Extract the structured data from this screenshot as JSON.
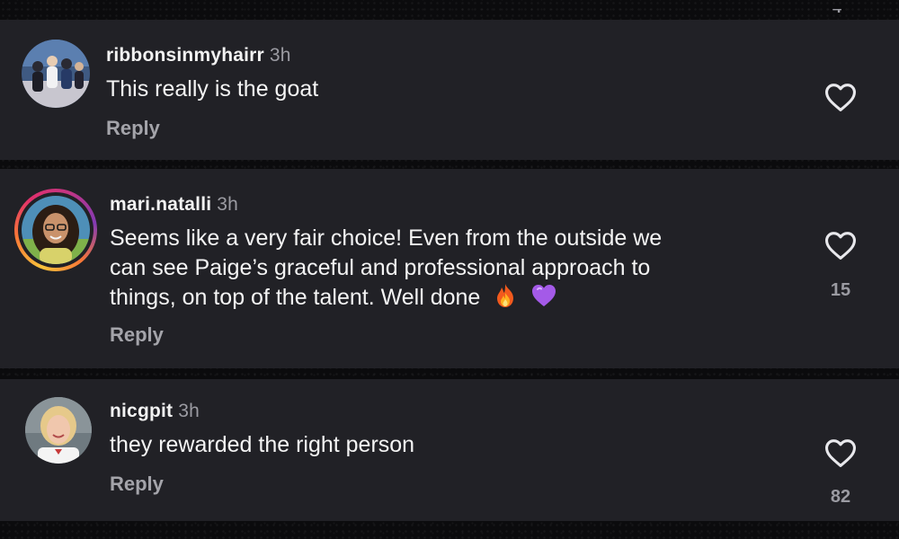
{
  "header_partial": {
    "count": "4"
  },
  "comments": [
    {
      "username": "ribbonsinmyhairr",
      "time": "3h",
      "text_lines": [
        "This really is the goat"
      ],
      "reply_label": "Reply",
      "like_count": "",
      "has_story_ring": false,
      "avatar_icon": "group-photo-avatar"
    },
    {
      "username": "mari.natalli",
      "time": "3h",
      "text_lines": [
        "Seems like a very fair choice! Even from the outside we",
        "can see Paige’s graceful and professional approach to",
        "things, on top of the talent. Well done"
      ],
      "emojis": [
        "fire-emoji",
        "purple-heart-emoji"
      ],
      "reply_label": "Reply",
      "like_count": "15",
      "has_story_ring": true,
      "avatar_icon": "woman-glasses-avatar"
    },
    {
      "username": "nicgpit",
      "time": "3h",
      "text_lines": [
        "they rewarded the right person"
      ],
      "reply_label": "Reply",
      "like_count": "82",
      "has_story_ring": false,
      "avatar_icon": "blonde-woman-avatar"
    }
  ],
  "colors": {
    "card_background": "#212126",
    "page_background": "#0b0b0d",
    "username": "#f2f2f2",
    "meta_text": "#9b9ba2"
  }
}
